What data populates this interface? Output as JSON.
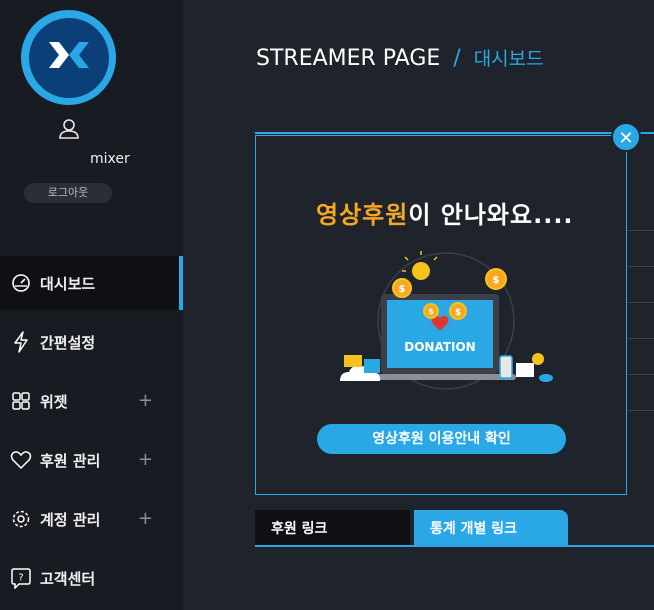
{
  "sidebar": {
    "username": "mixer",
    "logout_label": "로그아웃",
    "items": [
      {
        "label": "대시보드",
        "icon": "gauge-icon",
        "active": true,
        "expandable": false
      },
      {
        "label": "간편설정",
        "icon": "lightning-icon",
        "active": false,
        "expandable": false
      },
      {
        "label": "위젯",
        "icon": "widget-grid-icon",
        "active": false,
        "expandable": true
      },
      {
        "label": "후원 관리",
        "icon": "heart-icon",
        "active": false,
        "expandable": true
      },
      {
        "label": "계정 관리",
        "icon": "gear-icon",
        "active": false,
        "expandable": true
      },
      {
        "label": "고객센터",
        "icon": "help-icon",
        "active": false,
        "expandable": false
      }
    ],
    "plus_symbol": "+"
  },
  "header": {
    "title": "STREAMER PAGE",
    "separator": "/",
    "breadcrumb": "대시보드"
  },
  "modal": {
    "heading_highlight": "영상후원",
    "heading_rest": "이 안나와요....",
    "donation_text": "DONATION",
    "guide_button": "영상후원 이용안내 확인",
    "close_symbol": "✕"
  },
  "tabs": [
    {
      "label": "후원 링크",
      "active": false
    },
    {
      "label": "통계 개별 링크",
      "active": true
    }
  ],
  "colors": {
    "accent": "#2aa8e6",
    "highlight": "#f6a821",
    "sidebar_bg": "#181b21",
    "page_bg": "#1f232b"
  }
}
